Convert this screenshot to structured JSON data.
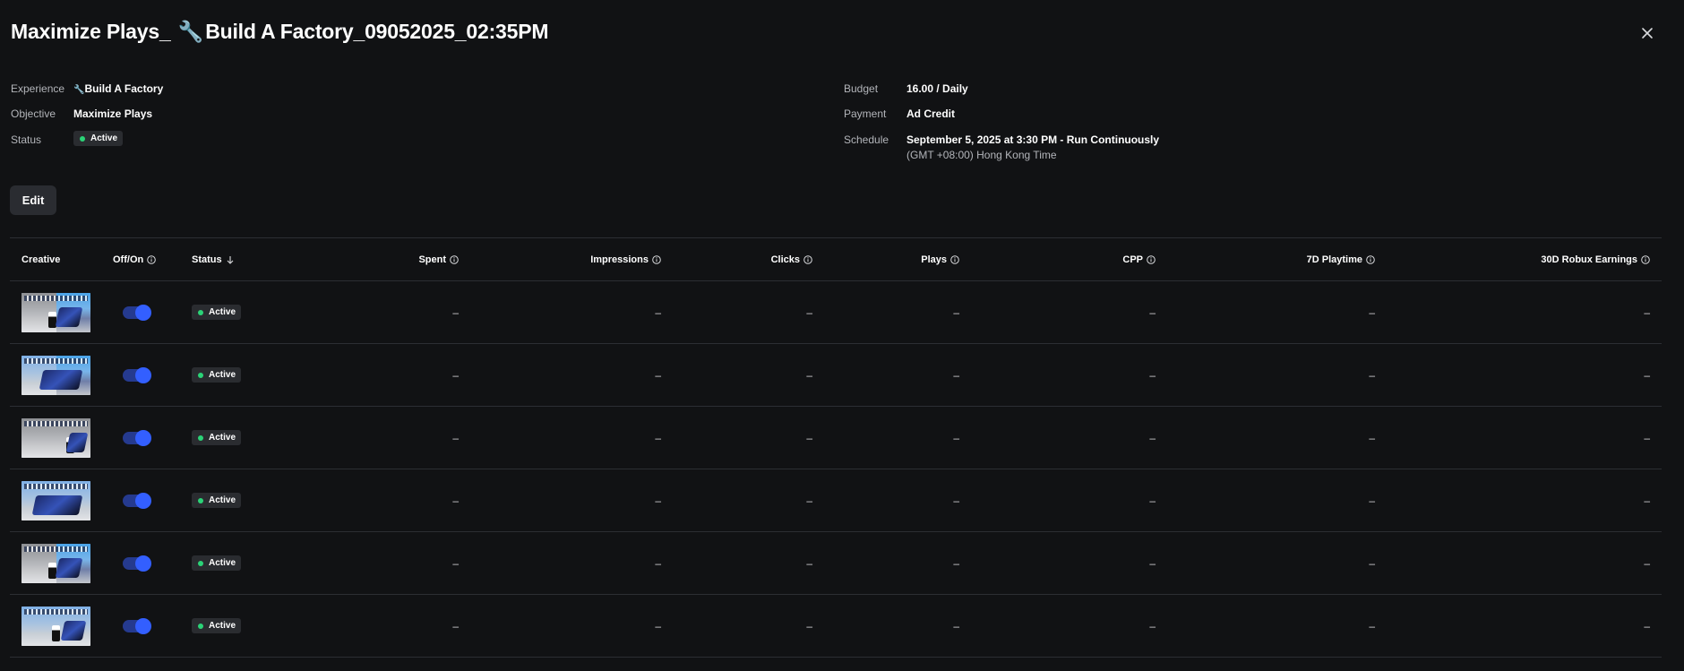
{
  "header": {
    "title_prefix": "Maximize Plays_",
    "title_suffix": "Build A Factory_09052025_02:35PM",
    "close_label": "Close"
  },
  "details": {
    "experience_label": "Experience",
    "experience_value": "Build A Factory",
    "objective_label": "Objective",
    "objective_value": "Maximize Plays",
    "status_label": "Status",
    "status_value": "Active",
    "budget_label": "Budget",
    "budget_value": "16.00 / Daily",
    "payment_label": "Payment",
    "payment_value": "Ad Credit",
    "schedule_label": "Schedule",
    "schedule_value": "September 5, 2025 at 3:30 PM - Run Continuously",
    "schedule_timezone": "(GMT +08:00) Hong Kong Time"
  },
  "edit_label": "Edit",
  "table": {
    "columns": {
      "creative": "Creative",
      "offon": "Off/On",
      "status": "Status",
      "spent": "Spent",
      "impressions": "Impressions",
      "clicks": "Clicks",
      "plays": "Plays",
      "cpp": "CPP",
      "playtime": "7D Playtime",
      "earnings": "30D Robux Earnings"
    },
    "rows": [
      {
        "status": "Active",
        "enabled": true,
        "spent": "–",
        "impressions": "–",
        "clicks": "–",
        "plays": "–",
        "cpp": "–",
        "playtime": "–",
        "earnings": "–"
      },
      {
        "status": "Active",
        "enabled": true,
        "spent": "–",
        "impressions": "–",
        "clicks": "–",
        "plays": "–",
        "cpp": "–",
        "playtime": "–",
        "earnings": "–"
      },
      {
        "status": "Active",
        "enabled": true,
        "spent": "–",
        "impressions": "–",
        "clicks": "–",
        "plays": "–",
        "cpp": "–",
        "playtime": "–",
        "earnings": "–"
      },
      {
        "status": "Active",
        "enabled": true,
        "spent": "–",
        "impressions": "–",
        "clicks": "–",
        "plays": "–",
        "cpp": "–",
        "playtime": "–",
        "earnings": "–"
      },
      {
        "status": "Active",
        "enabled": true,
        "spent": "–",
        "impressions": "–",
        "clicks": "–",
        "plays": "–",
        "cpp": "–",
        "playtime": "–",
        "earnings": "–"
      },
      {
        "status": "Active",
        "enabled": true,
        "spent": "–",
        "impressions": "–",
        "clicks": "–",
        "plays": "–",
        "cpp": "–",
        "playtime": "–",
        "earnings": "–"
      }
    ]
  },
  "colors": {
    "background": "#111214",
    "status_active": "#2bd377",
    "toggle_on": "#335fff",
    "divider": "#2c2e33"
  }
}
